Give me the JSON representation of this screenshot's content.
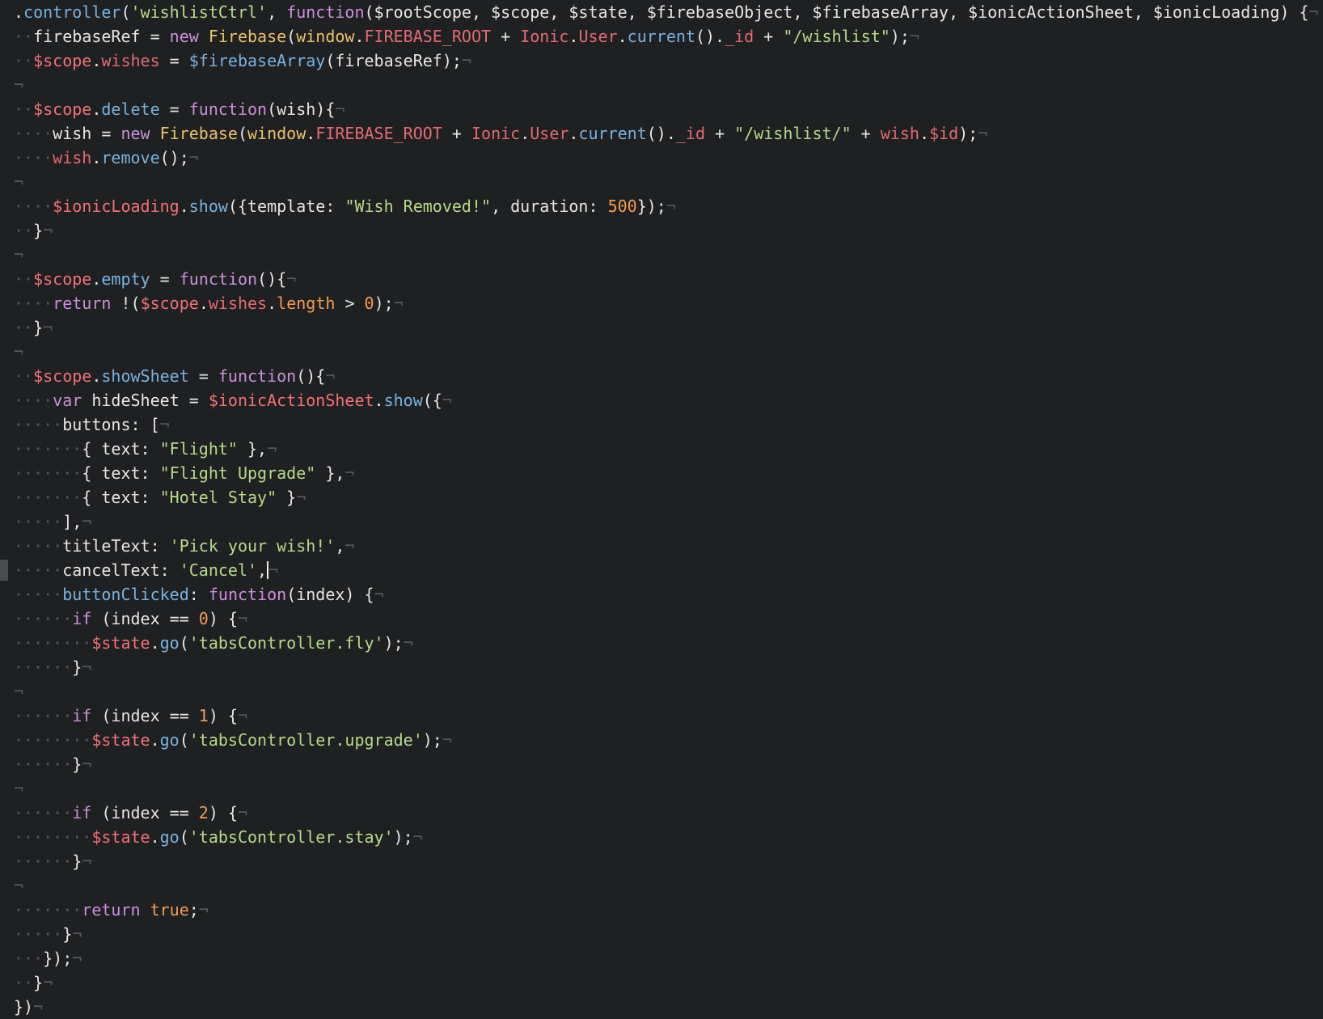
{
  "editor": {
    "whitespace_glyph": "·",
    "newline_glyph": "¬",
    "cursor_line": 23,
    "lines": [
      {
        "indent": 0,
        "tokens": [
          [
            ".",
            "punct"
          ],
          [
            "controller",
            "fn"
          ],
          [
            "(",
            "punct"
          ],
          [
            "'wishlistCtrl'",
            "str"
          ],
          [
            ", ",
            "punct"
          ],
          [
            "function",
            "kw"
          ],
          [
            "($rootScope, $scope, $state, $firebaseObject, $firebaseArray, $ionicActionSheet, $ionicLoading) {",
            "default"
          ]
        ]
      },
      {
        "indent": 2,
        "tokens": [
          [
            "firebaseRef = ",
            "default"
          ],
          [
            "new ",
            "kw"
          ],
          [
            "Firebase",
            "cls"
          ],
          [
            "(",
            "punct"
          ],
          [
            "window",
            "cls"
          ],
          [
            ".",
            "punct"
          ],
          [
            "FIREBASE_ROOT",
            "prop"
          ],
          [
            " + ",
            "default"
          ],
          [
            "Ionic",
            "prop"
          ],
          [
            ".",
            "punct"
          ],
          [
            "User",
            "prop"
          ],
          [
            ".",
            "punct"
          ],
          [
            "current",
            "fn"
          ],
          [
            "().",
            "punct"
          ],
          [
            "_id",
            "prop"
          ],
          [
            " + ",
            "default"
          ],
          [
            "\"/wishlist\"",
            "str"
          ],
          [
            ");",
            "punct"
          ]
        ]
      },
      {
        "indent": 2,
        "tokens": [
          [
            "$scope",
            "var"
          ],
          [
            ".",
            "punct"
          ],
          [
            "wishes",
            "prop"
          ],
          [
            " = ",
            "default"
          ],
          [
            "$firebaseArray",
            "fn"
          ],
          [
            "(firebaseRef);",
            "default"
          ]
        ]
      },
      {
        "indent": 0,
        "tokens": []
      },
      {
        "indent": 2,
        "tokens": [
          [
            "$scope",
            "var"
          ],
          [
            ".",
            "punct"
          ],
          [
            "delete",
            "fn"
          ],
          [
            " = ",
            "default"
          ],
          [
            "function",
            "kw"
          ],
          [
            "(wish){",
            "default"
          ]
        ]
      },
      {
        "indent": 4,
        "tokens": [
          [
            "wish = ",
            "default"
          ],
          [
            "new ",
            "kw"
          ],
          [
            "Firebase",
            "cls"
          ],
          [
            "(",
            "punct"
          ],
          [
            "window",
            "cls"
          ],
          [
            ".",
            "punct"
          ],
          [
            "FIREBASE_ROOT",
            "prop"
          ],
          [
            " + ",
            "default"
          ],
          [
            "Ionic",
            "prop"
          ],
          [
            ".",
            "punct"
          ],
          [
            "User",
            "prop"
          ],
          [
            ".",
            "punct"
          ],
          [
            "current",
            "fn"
          ],
          [
            "().",
            "punct"
          ],
          [
            "_id",
            "prop"
          ],
          [
            " + ",
            "default"
          ],
          [
            "\"/wishlist/\"",
            "str"
          ],
          [
            " + ",
            "default"
          ],
          [
            "wish",
            "prop"
          ],
          [
            ".",
            "punct"
          ],
          [
            "$id",
            "prop"
          ],
          [
            ");",
            "punct"
          ]
        ]
      },
      {
        "indent": 4,
        "tokens": [
          [
            "wish",
            "prop"
          ],
          [
            ".",
            "punct"
          ],
          [
            "remove",
            "fn"
          ],
          [
            "();",
            "punct"
          ]
        ]
      },
      {
        "indent": 0,
        "tokens": []
      },
      {
        "indent": 4,
        "tokens": [
          [
            "$ionicLoading",
            "var"
          ],
          [
            ".",
            "punct"
          ],
          [
            "show",
            "fn"
          ],
          [
            "({template: ",
            "default"
          ],
          [
            "\"Wish Removed!\"",
            "str"
          ],
          [
            ", duration: ",
            "default"
          ],
          [
            "500",
            "num"
          ],
          [
            "});",
            "punct"
          ]
        ]
      },
      {
        "indent": 2,
        "tokens": [
          [
            "}",
            "punct"
          ]
        ]
      },
      {
        "indent": 0,
        "tokens": []
      },
      {
        "indent": 2,
        "tokens": [
          [
            "$scope",
            "var"
          ],
          [
            ".",
            "punct"
          ],
          [
            "empty",
            "fn"
          ],
          [
            " = ",
            "default"
          ],
          [
            "function",
            "kw"
          ],
          [
            "(){",
            "default"
          ]
        ]
      },
      {
        "indent": 4,
        "tokens": [
          [
            "return ",
            "kw"
          ],
          [
            "!(",
            "default"
          ],
          [
            "$scope",
            "var"
          ],
          [
            ".",
            "punct"
          ],
          [
            "wishes",
            "prop"
          ],
          [
            ".",
            "punct"
          ],
          [
            "length",
            "num"
          ],
          [
            " > ",
            "default"
          ],
          [
            "0",
            "num"
          ],
          [
            ");",
            "punct"
          ]
        ]
      },
      {
        "indent": 2,
        "tokens": [
          [
            "}",
            "punct"
          ]
        ]
      },
      {
        "indent": 0,
        "tokens": []
      },
      {
        "indent": 2,
        "tokens": [
          [
            "$scope",
            "var"
          ],
          [
            ".",
            "punct"
          ],
          [
            "showSheet",
            "fn"
          ],
          [
            " = ",
            "default"
          ],
          [
            "function",
            "kw"
          ],
          [
            "(){",
            "default"
          ]
        ]
      },
      {
        "indent": 4,
        "tokens": [
          [
            "var ",
            "kw"
          ],
          [
            "hideSheet = ",
            "default"
          ],
          [
            "$ionicActionSheet",
            "var"
          ],
          [
            ".",
            "punct"
          ],
          [
            "show",
            "fn"
          ],
          [
            "({",
            "punct"
          ]
        ]
      },
      {
        "indent": 5,
        "tokens": [
          [
            "buttons: [",
            "default"
          ]
        ]
      },
      {
        "indent": 7,
        "tokens": [
          [
            "{ text: ",
            "default"
          ],
          [
            "\"Flight\"",
            "str"
          ],
          [
            " },",
            "default"
          ]
        ]
      },
      {
        "indent": 7,
        "tokens": [
          [
            "{ text: ",
            "default"
          ],
          [
            "\"Flight Upgrade\"",
            "str"
          ],
          [
            " },",
            "default"
          ]
        ]
      },
      {
        "indent": 7,
        "tokens": [
          [
            "{ text: ",
            "default"
          ],
          [
            "\"Hotel Stay\"",
            "str"
          ],
          [
            " }",
            "default"
          ]
        ]
      },
      {
        "indent": 5,
        "tokens": [
          [
            "],",
            "default"
          ]
        ]
      },
      {
        "indent": 5,
        "tokens": [
          [
            "titleText: ",
            "default"
          ],
          [
            "'Pick your wish!'",
            "str"
          ],
          [
            ",",
            "punct"
          ]
        ]
      },
      {
        "indent": 5,
        "tokens": [
          [
            "cancelText: ",
            "default"
          ],
          [
            "'Cancel'",
            "str"
          ],
          [
            ",",
            "punct"
          ]
        ]
      },
      {
        "indent": 5,
        "tokens": [
          [
            "buttonClicked",
            "fn"
          ],
          [
            ": ",
            "default"
          ],
          [
            "function",
            "kw"
          ],
          [
            "(index) {",
            "default"
          ]
        ]
      },
      {
        "indent": 6,
        "tokens": [
          [
            "if ",
            "kw"
          ],
          [
            "(index == ",
            "default"
          ],
          [
            "0",
            "num"
          ],
          [
            ") {",
            "default"
          ]
        ]
      },
      {
        "indent": 8,
        "tokens": [
          [
            "$state",
            "var"
          ],
          [
            ".",
            "punct"
          ],
          [
            "go",
            "fn"
          ],
          [
            "(",
            "punct"
          ],
          [
            "'tabsController.fly'",
            "str"
          ],
          [
            ");",
            "punct"
          ]
        ]
      },
      {
        "indent": 6,
        "tokens": [
          [
            "}",
            "punct"
          ]
        ]
      },
      {
        "indent": 0,
        "tokens": []
      },
      {
        "indent": 6,
        "tokens": [
          [
            "if ",
            "kw"
          ],
          [
            "(index == ",
            "default"
          ],
          [
            "1",
            "num"
          ],
          [
            ") {",
            "default"
          ]
        ]
      },
      {
        "indent": 8,
        "tokens": [
          [
            "$state",
            "var"
          ],
          [
            ".",
            "punct"
          ],
          [
            "go",
            "fn"
          ],
          [
            "(",
            "punct"
          ],
          [
            "'tabsController.upgrade'",
            "str"
          ],
          [
            ");",
            "punct"
          ]
        ]
      },
      {
        "indent": 6,
        "tokens": [
          [
            "}",
            "punct"
          ]
        ]
      },
      {
        "indent": 0,
        "tokens": []
      },
      {
        "indent": 6,
        "tokens": [
          [
            "if ",
            "kw"
          ],
          [
            "(index == ",
            "default"
          ],
          [
            "2",
            "num"
          ],
          [
            ") {",
            "default"
          ]
        ]
      },
      {
        "indent": 8,
        "tokens": [
          [
            "$state",
            "var"
          ],
          [
            ".",
            "punct"
          ],
          [
            "go",
            "fn"
          ],
          [
            "(",
            "punct"
          ],
          [
            "'tabsController.stay'",
            "str"
          ],
          [
            ");",
            "punct"
          ]
        ]
      },
      {
        "indent": 6,
        "tokens": [
          [
            "}",
            "punct"
          ]
        ]
      },
      {
        "indent": 0,
        "tokens": []
      },
      {
        "indent": 7,
        "tokens": [
          [
            "return ",
            "kw"
          ],
          [
            "true",
            "bool"
          ],
          [
            ";",
            "punct"
          ]
        ]
      },
      {
        "indent": 5,
        "tokens": [
          [
            "}",
            "punct"
          ]
        ]
      },
      {
        "indent": 3,
        "tokens": [
          [
            "});",
            "punct"
          ]
        ]
      },
      {
        "indent": 2,
        "tokens": [
          [
            "}",
            "punct"
          ]
        ]
      },
      {
        "indent": 0,
        "tokens": [
          [
            "})",
            "punct"
          ]
        ]
      }
    ]
  }
}
